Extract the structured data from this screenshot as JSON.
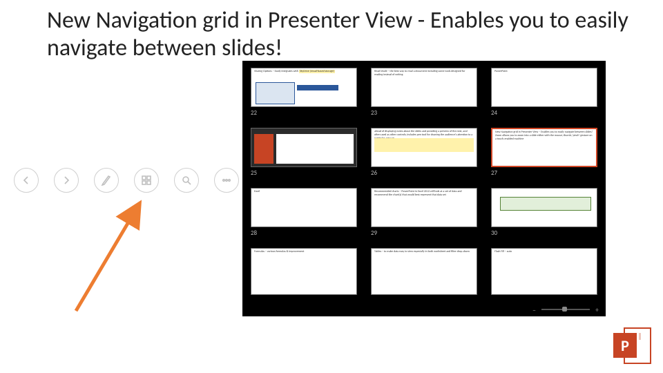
{
  "title": "New Navigation grid in Presenter View - Enables you to easily navigate between slides!",
  "toolbar": {
    "prev": "Previous slide",
    "next": "Next slide",
    "pen": "Pen tool",
    "grid": "Show all slides",
    "zoom": "Zoom",
    "more": "More options"
  },
  "thumbs": [
    {
      "n": "22",
      "head": "Sharing Options – Easily integrates with SkyDrive (cloud-based storage)",
      "sel": false
    },
    {
      "n": "23",
      "head": "Read Mode – the best way to read a document including some tools designed for reading instead of writing",
      "sel": false
    },
    {
      "n": "24",
      "head": "PowerPoint",
      "sel": false
    },
    {
      "n": "25",
      "head": "",
      "sel": false
    },
    {
      "n": "26",
      "head": "ahead of displaying notes about the slides and providing a preview of the next, and often used as other controls; includes pen tool for drawing the audience's attention to a particular area on",
      "sel": false
    },
    {
      "n": "27",
      "head": "New Navigation grid in Presenter View – Enables you to easily navigate between slides! Zoom allows you to zoom into a slide either with the mouse; thumb; 'pinch' gesture on a touch‑enabled machine",
      "sel": true
    },
    {
      "n": "28",
      "head": "Excel",
      "sel": false
    },
    {
      "n": "29",
      "head": "Recommended charts – PowerPoint in Excel 2013 will look at a set of data and recommend the chart(s) that would best represent that data set",
      "sel": false
    },
    {
      "n": "30",
      "head": "",
      "sel": false
    },
    {
      "n": "",
      "head": "Formulas – various formulas & improvement",
      "sel": false
    },
    {
      "n": "",
      "head": "Tables – to make data easy to view especially in both worksheet and filter drop‑down",
      "sel": false
    },
    {
      "n": "",
      "head": "Flash Fill – auto",
      "sel": false
    }
  ],
  "footer": {
    "minus": "–",
    "plus": "+"
  },
  "logo": {
    "letter": "P"
  }
}
